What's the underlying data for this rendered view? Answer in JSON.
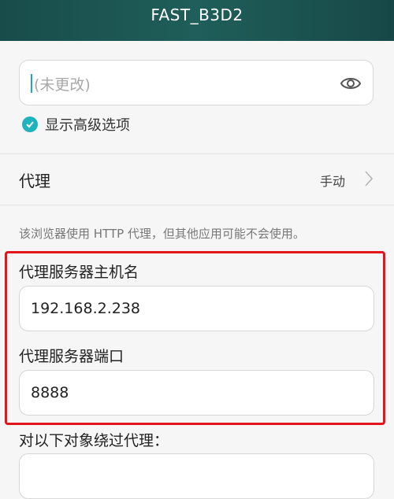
{
  "header": {
    "title": "FAST_B3D2"
  },
  "password": {
    "placeholder": "(未更改)",
    "icon": "eye-icon"
  },
  "advanced": {
    "label": "显示高级选项",
    "checked": true,
    "accent": "#20b3be"
  },
  "proxy": {
    "label": "代理",
    "value": "手动",
    "icon": "chevron-right-icon"
  },
  "note": "该浏览器使用 HTTP 代理，但其他应用可能不会使用。",
  "proxy_host": {
    "label": "代理服务器主机名",
    "value": "192.168.2.238"
  },
  "proxy_port": {
    "label": "代理服务器端口",
    "value": "8888"
  },
  "bypass": {
    "label": "对以下对象绕过代理：",
    "value": ""
  },
  "colors": {
    "header": "#1d5a57",
    "accent": "#20b3be",
    "highlight": "#e0161c"
  }
}
